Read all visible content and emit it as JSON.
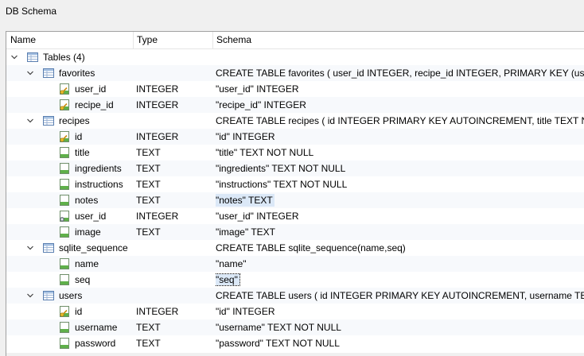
{
  "window": {
    "title": "DB Schema"
  },
  "header": {
    "name": "Name",
    "type": "Type",
    "schema": "Schema"
  },
  "root": {
    "label": "Tables (4)"
  },
  "tables": [
    {
      "name": "favorites",
      "schema": "CREATE TABLE favorites ( user_id INTEGER, recipe_id INTEGER, PRIMARY KEY (us",
      "columns": [
        {
          "name": "user_id",
          "type": "INTEGER",
          "schema": "\"user_id\" INTEGER",
          "key": true
        },
        {
          "name": "recipe_id",
          "type": "INTEGER",
          "schema": "\"recipe_id\" INTEGER",
          "key": true
        }
      ]
    },
    {
      "name": "recipes",
      "schema": "CREATE TABLE recipes ( id INTEGER PRIMARY KEY AUTOINCREMENT, title TEXT N",
      "columns": [
        {
          "name": "id",
          "type": "INTEGER",
          "schema": "\"id\" INTEGER",
          "key": true
        },
        {
          "name": "title",
          "type": "TEXT",
          "schema": "\"title\" TEXT NOT NULL"
        },
        {
          "name": "ingredients",
          "type": "TEXT",
          "schema": "\"ingredients\" TEXT NOT NULL"
        },
        {
          "name": "instructions",
          "type": "TEXT",
          "schema": "\"instructions\" TEXT NOT NULL"
        },
        {
          "name": "notes",
          "type": "TEXT",
          "schema": "\"notes\" TEXT",
          "selected": true
        },
        {
          "name": "user_id",
          "type": "INTEGER",
          "schema": "\"user_id\" INTEGER",
          "foreign": true
        },
        {
          "name": "image",
          "type": "TEXT",
          "schema": "\"image\" TEXT"
        }
      ]
    },
    {
      "name": "sqlite_sequence",
      "schema": "CREATE TABLE sqlite_sequence(name,seq)",
      "columns": [
        {
          "name": "name",
          "type": "",
          "schema": "\"name\""
        },
        {
          "name": "seq",
          "type": "",
          "schema": "\"seq\"",
          "focused": true
        }
      ]
    },
    {
      "name": "users",
      "schema": "CREATE TABLE users ( id INTEGER PRIMARY KEY AUTOINCREMENT, username TE",
      "columns": [
        {
          "name": "id",
          "type": "INTEGER",
          "schema": "\"id\" INTEGER",
          "key": true
        },
        {
          "name": "username",
          "type": "TEXT",
          "schema": "\"username\" TEXT NOT NULL"
        },
        {
          "name": "password",
          "type": "TEXT",
          "schema": "\"password\" TEXT NOT NULL"
        }
      ]
    }
  ]
}
